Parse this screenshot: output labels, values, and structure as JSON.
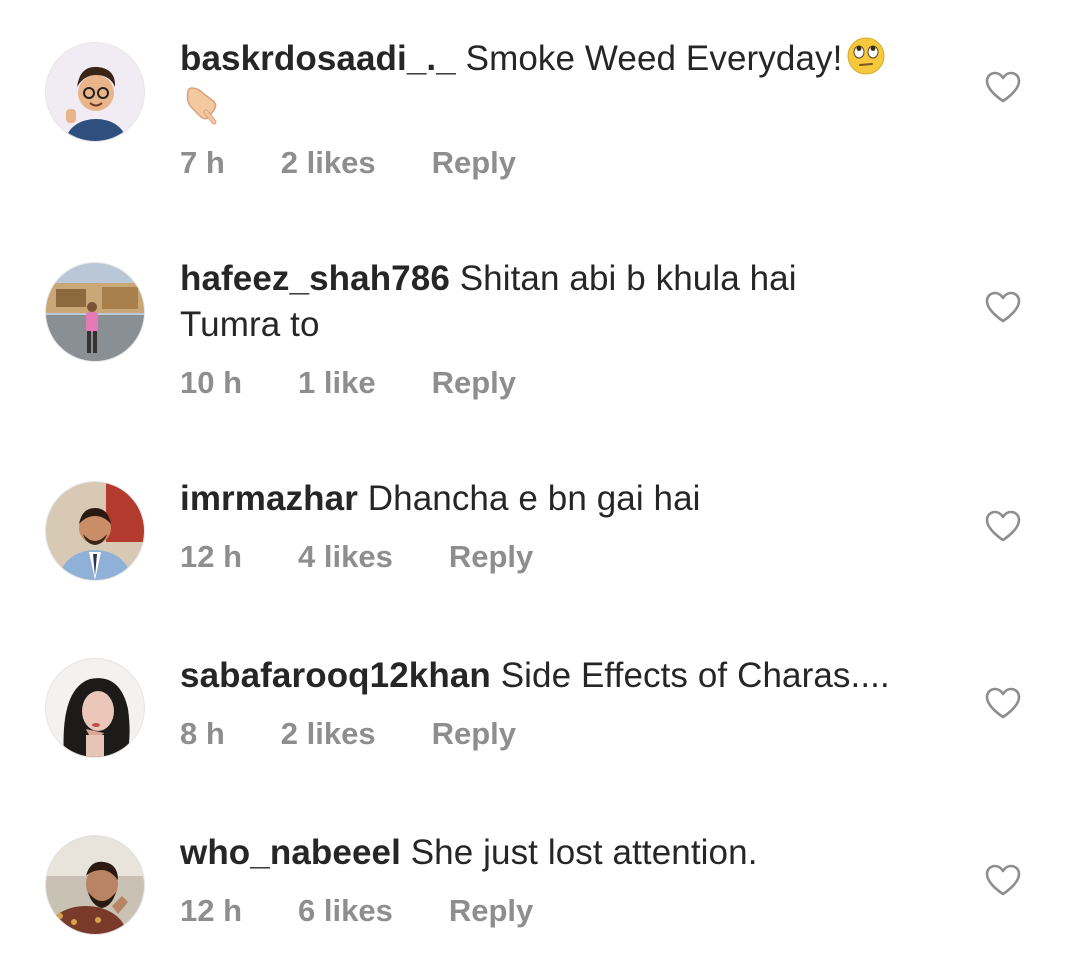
{
  "comments": [
    {
      "username": "baskrdosaadi_._",
      "text": "Smoke Weed Everyday!",
      "emoji_1": "face-with-rolling-eyes-emoji",
      "emoji_2": "hand-pointing-down-emoji",
      "time": "7 h",
      "likes": "2 likes",
      "reply": "Reply"
    },
    {
      "username": "hafeez_shah786",
      "text": "Shitan abi b khula hai Tumra to",
      "time": "10 h",
      "likes": "1 like",
      "reply": "Reply"
    },
    {
      "username": "imrmazhar",
      "text": "Dhancha e bn gai hai",
      "time": "12 h",
      "likes": "4 likes",
      "reply": "Reply"
    },
    {
      "username": "sabafarooq12khan",
      "text": "Side Effects of Charas....",
      "time": "8 h",
      "likes": "2 likes",
      "reply": "Reply"
    },
    {
      "username": "who_nabeeel",
      "text": "She just lost attention.",
      "time": "12 h",
      "likes": "6 likes",
      "reply": "Reply"
    }
  ],
  "icons": {
    "heart": "heart-outline-icon"
  },
  "colors": {
    "text": "#262626",
    "meta": "#8e8e8e"
  }
}
